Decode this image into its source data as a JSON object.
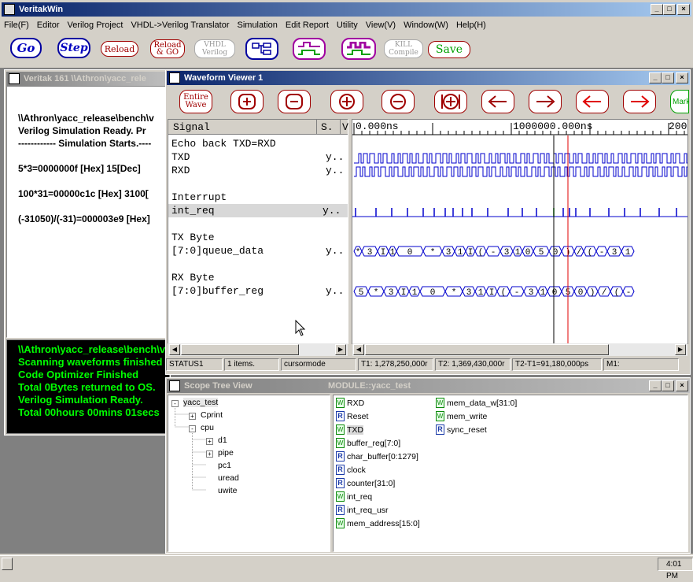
{
  "app": {
    "title": "VeritakWin"
  },
  "menu": [
    "File(F)",
    "Editor",
    "Verilog Project",
    "VHDL->Verilog Translator",
    "Simulation",
    "Edit Report",
    "Utility",
    "View(V)",
    "Window(W)",
    "Help(H)"
  ],
  "toolbar": {
    "go": "Go",
    "step": "Step",
    "reload": "Reload",
    "reload_go_1": "Reload",
    "reload_go_2": "& GO",
    "vhdl_1": "VHDL",
    "vhdl_2": "Verilog",
    "kill_1": "KILL",
    "kill_2": "Compile",
    "save": "Save"
  },
  "console": {
    "title": "Veritak 161 \\\\Athron\\yacc_rele",
    "lines": [
      "\\\\Athron\\yacc_release\\bench\\v",
      "Verilog Simulation Ready. Pr",
      "------------ Simulation Starts.----",
      "",
      "5*3=0000000f [Hex]    15[Dec]",
      "",
      "100*31=00000c1c [Hex]    3100[",
      "",
      "(-31050)/(-31)=000003e9 [Hex]"
    ],
    "log": [
      "\\\\Athron\\yacc_release\\bench\\v",
      "Scanning waveforms finished",
      "Code Optimizer Finished",
      "Total 0Bytes returned to OS.",
      "Verilog Simulation Ready.",
      "Total  00hours 00mins 01secs"
    ]
  },
  "waveform": {
    "title": "Waveform Viewer 1",
    "entire_wave_1": "Entire",
    "entire_wave_2": "Wave",
    "mark": "Mark",
    "col_signal": "Signal",
    "col_s": "S.",
    "col_v": "V",
    "time0": "0.000ns",
    "time1": "1000000.000ns",
    "time2": "200",
    "signals": [
      {
        "name": "Echo back TXD=RXD",
        "val": ""
      },
      {
        "name": "TXD",
        "val": "y.."
      },
      {
        "name": "RXD",
        "val": "y.."
      },
      {
        "name": "",
        "val": ""
      },
      {
        "name": "Interrupt",
        "val": ""
      },
      {
        "name": "int_req",
        "val": "y.."
      },
      {
        "name": "",
        "val": ""
      },
      {
        "name": "TX Byte",
        "val": ""
      },
      {
        "name": "[7:0]queue_data",
        "val": "y.."
      },
      {
        "name": "",
        "val": ""
      },
      {
        "name": "RX Byte",
        "val": ""
      },
      {
        "name": "[7:0]buffer_reg",
        "val": "y.."
      }
    ],
    "queue_labels": [
      "*",
      "3",
      "I",
      "1",
      "0",
      "*",
      "3",
      "1",
      "I",
      "(",
      "-",
      "3",
      "1",
      "0",
      "5",
      "0",
      ")",
      "/",
      "(",
      "-",
      "3",
      "1"
    ],
    "buffer_labels": [
      "5",
      "*",
      "3",
      "I",
      "1",
      "0",
      "*",
      "3",
      "1",
      "I",
      "(",
      "-",
      "3",
      "1",
      "0",
      "5",
      "0",
      ")",
      "/",
      "(",
      "-"
    ],
    "status": {
      "s1": "STATUS1",
      "items": "1 items.",
      "mode": "cursormode",
      "t1": "T1: 1,278,250,000r",
      "t2": "T2: 1,369,430,000r",
      "diff": "T2-T1=91,180,000ps",
      "m1": "M1:"
    }
  },
  "scope": {
    "title": "Scope Tree View",
    "module_title": "MODULE::yacc_test",
    "tree": [
      {
        "label": "yacc_test",
        "expander": "-"
      },
      {
        "label": "Cprint",
        "expander": "+"
      },
      {
        "label": "cpu",
        "expander": "-"
      },
      {
        "label": "d1",
        "expander": "+"
      },
      {
        "label": "pipe",
        "expander": "+"
      },
      {
        "label": "pc1",
        "expander": ""
      },
      {
        "label": "uread",
        "expander": ""
      },
      {
        "label": "uwite",
        "expander": ""
      }
    ],
    "signals_col1": [
      {
        "tag": "W",
        "name": "RXD"
      },
      {
        "tag": "R",
        "name": "Reset"
      },
      {
        "tag": "W",
        "name": "TXD"
      },
      {
        "tag": "W",
        "name": "buffer_reg[7:0]"
      },
      {
        "tag": "R",
        "name": "char_buffer[0:1279]"
      },
      {
        "tag": "R",
        "name": "clock"
      },
      {
        "tag": "R",
        "name": "counter[31:0]"
      },
      {
        "tag": "W",
        "name": "int_req"
      },
      {
        "tag": "R",
        "name": "int_req_usr"
      },
      {
        "tag": "W",
        "name": "mem_address[15:0]"
      }
    ],
    "signals_col2": [
      {
        "tag": "W",
        "name": "mem_data_w[31:0]"
      },
      {
        "tag": "W",
        "name": "mem_write"
      },
      {
        "tag": "R",
        "name": "sync_reset"
      }
    ]
  },
  "taskbar": {
    "clock": "4:01 PM"
  },
  "colors": {
    "title_active": "#0a246a",
    "console_green": "#00ff00",
    "wave_blue": "#0000cc",
    "cursor_red": "#e00000"
  }
}
